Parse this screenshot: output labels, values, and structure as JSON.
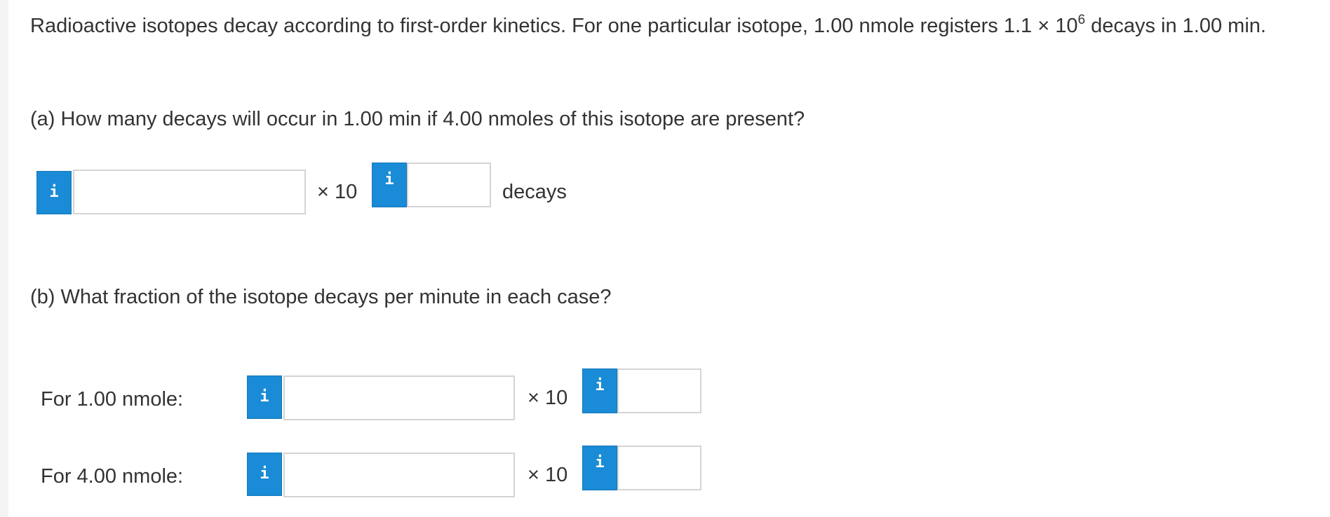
{
  "intro": {
    "text_before": "Radioactive isotopes decay according to first-order kinetics. For one particular isotope, 1.00 nmole registers 1.1 × 10",
    "exponent": "6",
    "text_after": " decays in 1.00 min."
  },
  "part_a": {
    "question": "(a) How many decays will occur in 1.00 min if 4.00 nmoles of this isotope are present?",
    "info_glyph": "i",
    "mantissa_value": "",
    "times_label": "× 10",
    "exponent_value": "",
    "unit": "decays"
  },
  "part_b": {
    "question": "(b) What fraction of the isotope decays per minute in each case?",
    "rows": [
      {
        "label": "For 1.00 nmole:",
        "info_glyph": "i",
        "mantissa_value": "",
        "times_label": "× 10",
        "exponent_value": ""
      },
      {
        "label": "For 4.00 nmole:",
        "info_glyph": "i",
        "mantissa_value": "",
        "times_label": "× 10",
        "exponent_value": ""
      }
    ]
  },
  "colors": {
    "info_button": "#1a8bd6",
    "text": "#333333",
    "field_border": "#d4d4d4"
  },
  "icons": {
    "info": "info-icon"
  }
}
